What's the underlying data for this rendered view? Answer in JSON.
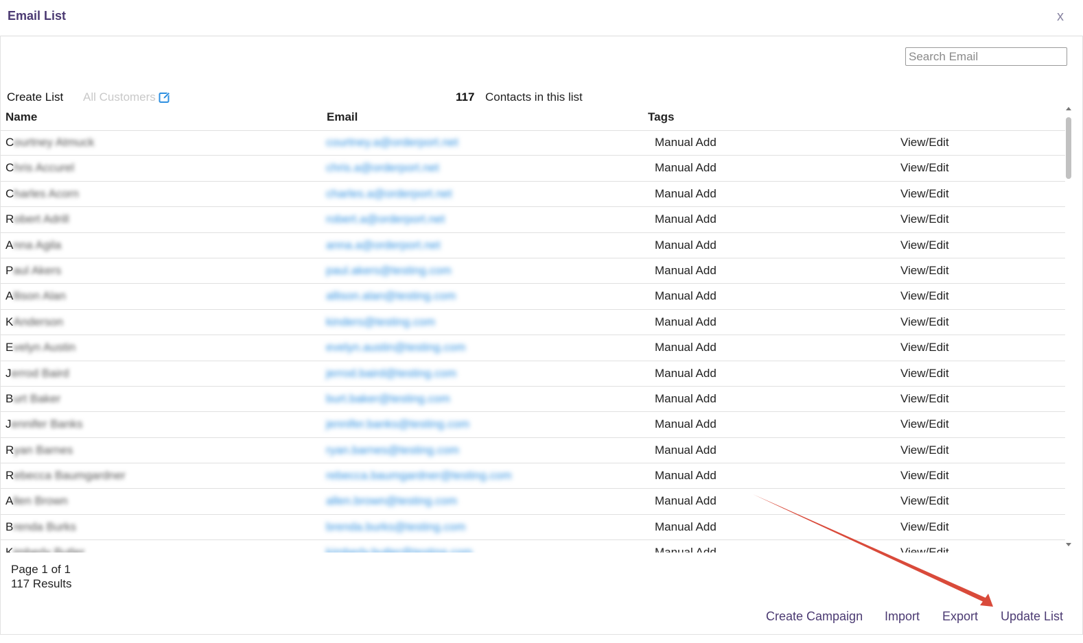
{
  "dialog": {
    "title": "Email List",
    "close_label": "x"
  },
  "search": {
    "placeholder": "Search Email",
    "value": ""
  },
  "list_header": {
    "create_label": "Create List",
    "list_name": "All Customers",
    "contact_count": "117",
    "contact_label": "Contacts in this list"
  },
  "table": {
    "columns": [
      "Name",
      "Email",
      "Tags"
    ],
    "rows": [
      {
        "name_initial": "C",
        "name_rest": "ourtney Atmuck",
        "email": "courtney.a@orderport.net",
        "tag": "Manual Add",
        "action": "View/Edit"
      },
      {
        "name_initial": "C",
        "name_rest": "hris Accurel",
        "email": "chris.a@orderport.net",
        "tag": "Manual Add",
        "action": "View/Edit"
      },
      {
        "name_initial": "C",
        "name_rest": "harles Acorn",
        "email": "charles.a@orderport.net",
        "tag": "Manual Add",
        "action": "View/Edit"
      },
      {
        "name_initial": "R",
        "name_rest": "obert Adrill",
        "email": "robert.a@orderport.net",
        "tag": "Manual Add",
        "action": "View/Edit"
      },
      {
        "name_initial": "A",
        "name_rest": "nna Agila",
        "email": "anna.a@orderport.net",
        "tag": "Manual Add",
        "action": "View/Edit"
      },
      {
        "name_initial": "P",
        "name_rest": "aul Akers",
        "email": "paul.akers@testing.com",
        "tag": "Manual Add",
        "action": "View/Edit"
      },
      {
        "name_initial": "A",
        "name_rest": "llison Alan",
        "email": "allison.alan@testing.com",
        "tag": "Manual Add",
        "action": "View/Edit"
      },
      {
        "name_initial": "K",
        "name_rest": " Anderson",
        "email": "kinders@testing.com",
        "tag": "Manual Add",
        "action": "View/Edit"
      },
      {
        "name_initial": "E",
        "name_rest": "velyn Austin",
        "email": "evelyn.austin@testing.com",
        "tag": "Manual Add",
        "action": "View/Edit"
      },
      {
        "name_initial": "J",
        "name_rest": "errod Baird",
        "email": "jerrod.baird@testing.com",
        "tag": "Manual Add",
        "action": "View/Edit"
      },
      {
        "name_initial": "B",
        "name_rest": "urt Baker",
        "email": "burt.baker@testing.com",
        "tag": "Manual Add",
        "action": "View/Edit"
      },
      {
        "name_initial": "J",
        "name_rest": "ennifer Banks",
        "email": "jennifer.banks@testing.com",
        "tag": "Manual Add",
        "action": "View/Edit"
      },
      {
        "name_initial": "R",
        "name_rest": "yan Barnes",
        "email": "ryan.barnes@testing.com",
        "tag": "Manual Add",
        "action": "View/Edit"
      },
      {
        "name_initial": "R",
        "name_rest": "ebecca Baumgardner",
        "email": "rebecca.baumgardner@testing.com",
        "tag": "Manual Add",
        "action": "View/Edit"
      },
      {
        "name_initial": "A",
        "name_rest": "llen Brown",
        "email": "allen.brown@testing.com",
        "tag": "Manual Add",
        "action": "View/Edit"
      },
      {
        "name_initial": "B",
        "name_rest": "renda Burks",
        "email": "brenda.burks@testing.com",
        "tag": "Manual Add",
        "action": "View/Edit"
      },
      {
        "name_initial": "K",
        "name_rest": "imberly Butler",
        "email": "kimberly.butler@testing.com",
        "tag": "Manual Add",
        "action": "View/Edit"
      }
    ]
  },
  "pagination": {
    "page_text": "Page 1 of 1",
    "results_text": "117 Results"
  },
  "footer": {
    "create_campaign": "Create Campaign",
    "import": "Import",
    "export": "Export",
    "update_list": "Update List"
  },
  "colors": {
    "title": "#4b3a72",
    "link": "#2d8fe0",
    "annotation_arrow": "#d94a3a"
  },
  "icons": {
    "edit": "edit-icon",
    "close": "close-icon"
  }
}
